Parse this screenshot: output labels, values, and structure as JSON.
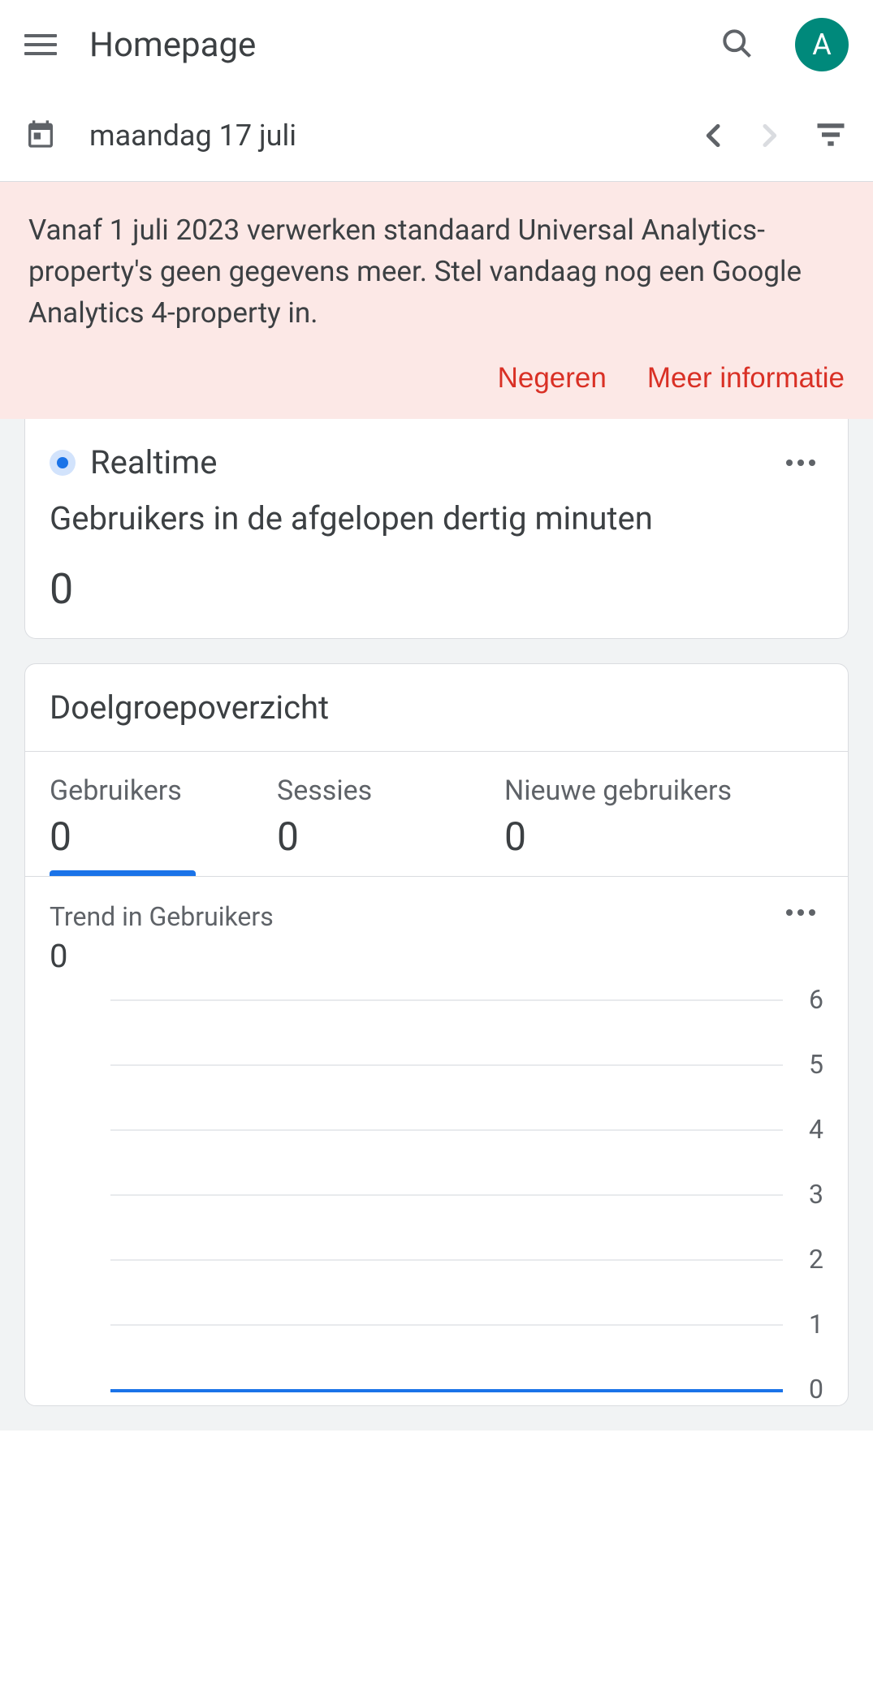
{
  "header": {
    "title": "Homepage",
    "avatar_letter": "A"
  },
  "date": {
    "label": "maandag 17 juli"
  },
  "notice": {
    "text": "Vanaf 1 juli 2023 verwerken standaard Universal Analytics-property's geen gegevens meer. Stel vandaag nog een Google Analytics 4-property in.",
    "dismiss": "Negeren",
    "more": "Meer informatie"
  },
  "realtime": {
    "title": "Realtime",
    "subtitle": "Gebruikers in de afgelopen dertig minuten",
    "value": "0"
  },
  "audience": {
    "title": "Doelgroepoverzicht",
    "metrics": [
      {
        "label": "Gebruikers",
        "value": "0"
      },
      {
        "label": "Sessies",
        "value": "0"
      },
      {
        "label": "Nieuwe gebruikers",
        "value": "0"
      }
    ],
    "trend": {
      "title": "Trend in Gebruikers",
      "value": "0"
    }
  },
  "chart_data": {
    "type": "line",
    "title": "Trend in Gebruikers",
    "ylabel": "",
    "xlabel": "",
    "ylim": [
      0,
      6
    ],
    "yticks": [
      0,
      1,
      2,
      3,
      4,
      5,
      6
    ],
    "series": [
      {
        "name": "Gebruikers",
        "values": [
          0
        ]
      }
    ]
  }
}
